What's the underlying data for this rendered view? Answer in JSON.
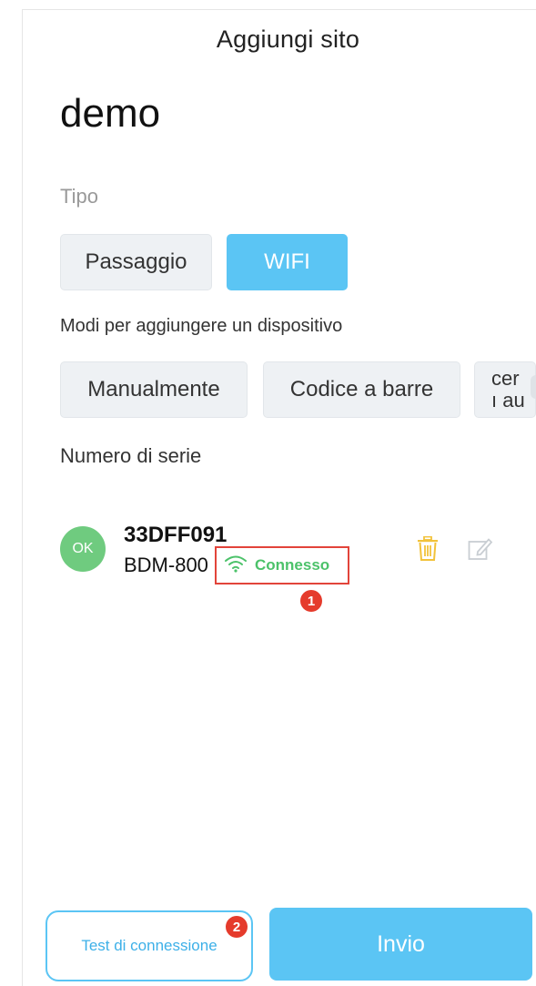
{
  "header": {
    "title": "Aggiungi sito"
  },
  "site": {
    "name": "demo"
  },
  "type_section": {
    "label": "Tipo",
    "options": [
      "Passaggio",
      "WIFI"
    ],
    "selected": "WIFI"
  },
  "add_methods": {
    "label": "Modi per aggiungere un dispositivo",
    "options": [
      "Manualmente",
      "Codice a barre"
    ],
    "partial_option": {
      "line1": "cer",
      "line2": "ı au"
    }
  },
  "serial_section": {
    "label": "Numero di serie"
  },
  "device": {
    "status_badge": "OK",
    "serial": "33DFF091",
    "model": "BDM-800",
    "connection_status": "Connesso",
    "connection_icon": "wifi-icon",
    "actions": [
      "trash-icon",
      "edit-icon"
    ]
  },
  "annotations": {
    "marker_1": "1",
    "marker_2": "2"
  },
  "footer": {
    "test_label": "Test di connessione",
    "submit_label": "Invio"
  },
  "colors": {
    "accent": "#5bc5f4",
    "connected_green": "#4cc26a",
    "ok_badge": "#6fcb7f",
    "highlight_red": "#e2443a",
    "trash_yellow": "#f2c23a"
  }
}
